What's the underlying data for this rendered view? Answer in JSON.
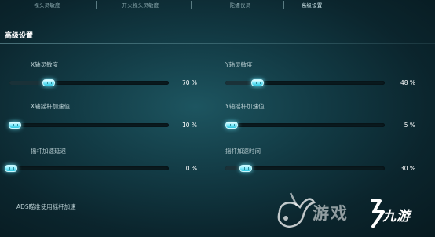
{
  "tabs": [
    {
      "label": "视头灵敏度",
      "active": false
    },
    {
      "label": "开火视头灵敏度",
      "active": false
    },
    {
      "label": "陀螺仪灵",
      "active": false
    },
    {
      "label": "高级设置",
      "active": true
    }
  ],
  "section_title": "高级设置",
  "settings": [
    {
      "label": "X轴灵敏度",
      "value": 70,
      "display": "70 %"
    },
    {
      "label": "Y轴灵敏度",
      "value": 48,
      "display": "48 %"
    },
    {
      "label": "X轴摇杆加速值",
      "value": 10,
      "display": "10 %"
    },
    {
      "label": "Y轴摇杆加速值",
      "value": 5,
      "display": "5 %"
    },
    {
      "label": "摇杆加速延迟",
      "value": 0,
      "display": "0 %"
    },
    {
      "label": "摇杆加速时间",
      "value": 30,
      "display": "30 %"
    }
  ],
  "ads_label": "ADS瞄准使用摇杆加速",
  "watermark": {
    "text": "游戏",
    "brand": "九游",
    "icon": "bird-logo-icon"
  }
}
